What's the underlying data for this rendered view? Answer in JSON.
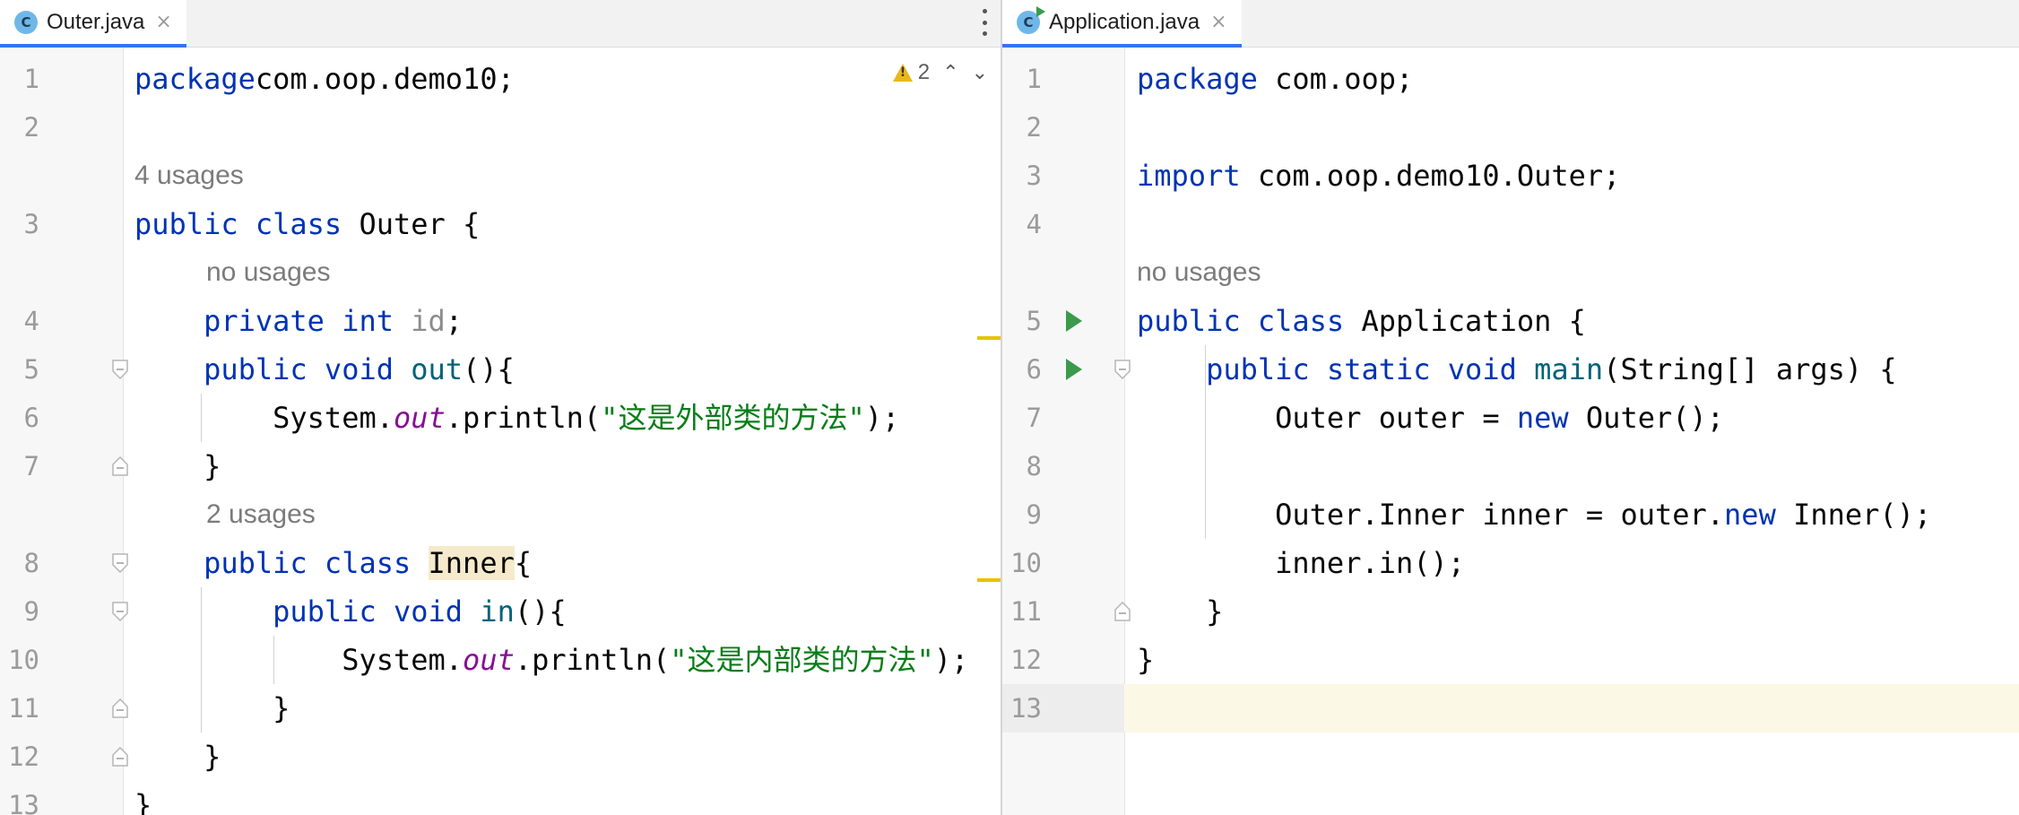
{
  "left_editor": {
    "tab": {
      "icon": "java-class-icon",
      "icon_letter": "C",
      "label": "Outer.java",
      "close": "×"
    },
    "inspection": {
      "icon": "warning-icon",
      "count": "2",
      "up": "⌃",
      "down": "⌄"
    },
    "lines": [
      {
        "n": "1",
        "seg": [
          [
            "kw",
            "package"
          ],
          [
            "",
            "com.oop.demo10;"
          ]
        ]
      },
      {
        "n": "2",
        "seg": []
      },
      {
        "usage": "4 usages"
      },
      {
        "n": "3",
        "seg": [
          [
            "kw",
            "public"
          ],
          [
            "",
            " "
          ],
          [
            "kw",
            "class"
          ],
          [
            "",
            " Outer {"
          ]
        ]
      },
      {
        "usage": "no usages",
        "indent": 1
      },
      {
        "n": "4",
        "seg": [
          [
            "",
            "    "
          ],
          [
            "kw",
            "private"
          ],
          [
            "",
            " "
          ],
          [
            "kw",
            "int"
          ],
          [
            "",
            " "
          ],
          [
            "unused",
            "id"
          ],
          [
            "",
            ";"
          ]
        ]
      },
      {
        "n": "5",
        "seg": [
          [
            "",
            "    "
          ],
          [
            "kw",
            "public"
          ],
          [
            "",
            " "
          ],
          [
            "kw",
            "void"
          ],
          [
            "",
            " "
          ],
          [
            "fn",
            "out"
          ],
          [
            "",
            "(){"
          ]
        ]
      },
      {
        "n": "6",
        "seg": [
          [
            "",
            "        System."
          ],
          [
            "static-fld",
            "out"
          ],
          [
            "",
            ".println("
          ],
          [
            "str",
            "\"这是外部类的方法\""
          ],
          [
            "",
            ");"
          ]
        ]
      },
      {
        "n": "7",
        "seg": [
          [
            "",
            "    }"
          ]
        ]
      },
      {
        "usage": "2 usages",
        "indent": 1
      },
      {
        "n": "8",
        "seg": [
          [
            "",
            "    "
          ],
          [
            "kw",
            "public"
          ],
          [
            "",
            " "
          ],
          [
            "kw",
            "class"
          ],
          [
            "",
            " "
          ],
          [
            "hl-inner",
            "Inner"
          ],
          [
            "",
            "{"
          ]
        ]
      },
      {
        "n": "9",
        "seg": [
          [
            "",
            "        "
          ],
          [
            "kw",
            "public"
          ],
          [
            "",
            " "
          ],
          [
            "kw",
            "void"
          ],
          [
            "",
            " "
          ],
          [
            "fn",
            "in"
          ],
          [
            "",
            "(){"
          ]
        ]
      },
      {
        "n": "10",
        "seg": [
          [
            "",
            "            System."
          ],
          [
            "static-fld",
            "out"
          ],
          [
            "",
            ".println("
          ],
          [
            "str",
            "\"这是内部类的方法\""
          ],
          [
            "",
            ");"
          ]
        ]
      },
      {
        "n": "11",
        "seg": [
          [
            "",
            "        }"
          ]
        ]
      },
      {
        "n": "12",
        "seg": [
          [
            "",
            "    }"
          ]
        ]
      },
      {
        "n": "13",
        "seg": [
          [
            "",
            "}"
          ]
        ]
      }
    ]
  },
  "right_editor": {
    "tab": {
      "icon": "java-class-run-icon",
      "icon_letter": "C",
      "label": "Application.java",
      "close": "×"
    },
    "lines": [
      {
        "n": "1",
        "seg": [
          [
            "kw",
            "package"
          ],
          [
            "",
            " com.oop;"
          ]
        ]
      },
      {
        "n": "2",
        "seg": []
      },
      {
        "n": "3",
        "seg": [
          [
            "kw",
            "import"
          ],
          [
            "",
            " com.oop.demo10.Outer;"
          ]
        ]
      },
      {
        "n": "4",
        "seg": []
      },
      {
        "usage": "no usages"
      },
      {
        "n": "5",
        "seg": [
          [
            "kw",
            "public"
          ],
          [
            "",
            " "
          ],
          [
            "kw",
            "class"
          ],
          [
            "",
            " Application {"
          ]
        ],
        "run": true
      },
      {
        "n": "6",
        "seg": [
          [
            "",
            "    "
          ],
          [
            "kw",
            "public"
          ],
          [
            "",
            " "
          ],
          [
            "kw",
            "static"
          ],
          [
            "",
            " "
          ],
          [
            "kw",
            "void"
          ],
          [
            "",
            " "
          ],
          [
            "fn",
            "main"
          ],
          [
            "",
            "(String[] args) {"
          ]
        ],
        "run": true
      },
      {
        "n": "7",
        "seg": [
          [
            "",
            "        Outer outer = "
          ],
          [
            "kw",
            "new"
          ],
          [
            "",
            " Outer();"
          ]
        ]
      },
      {
        "n": "8",
        "seg": []
      },
      {
        "n": "9",
        "seg": [
          [
            "",
            "        Outer.Inner inner = outer."
          ],
          [
            "kw",
            "new"
          ],
          [
            "",
            " Inner();"
          ]
        ]
      },
      {
        "n": "10",
        "seg": [
          [
            "",
            "        inner.in();"
          ]
        ]
      },
      {
        "n": "11",
        "seg": [
          [
            "",
            "    }"
          ]
        ]
      },
      {
        "n": "12",
        "seg": [
          [
            "",
            "}"
          ]
        ]
      },
      {
        "n": "13",
        "seg": [],
        "current": true
      }
    ]
  }
}
